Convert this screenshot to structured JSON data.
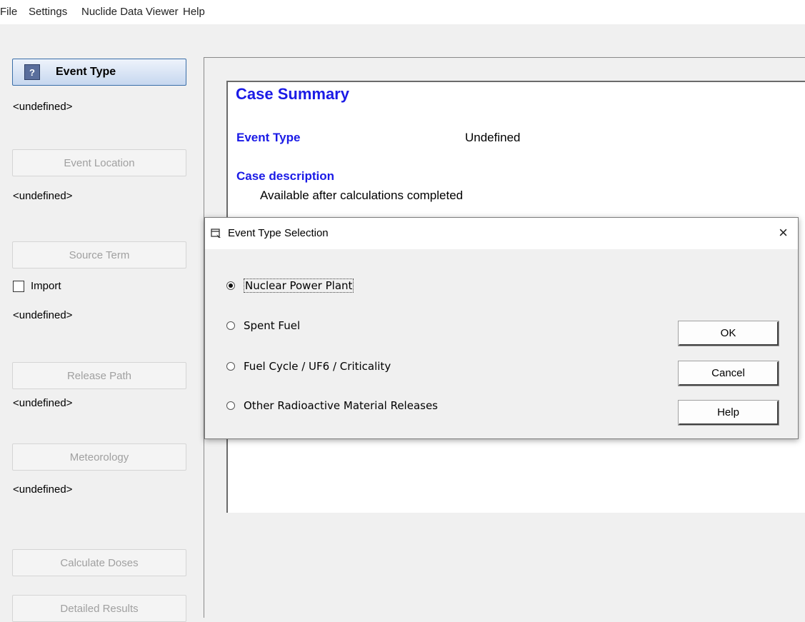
{
  "menu": [
    "File",
    "Settings",
    "Nuclide Data Viewer",
    "Help"
  ],
  "sidebar": {
    "event_type": {
      "icon_text": "?",
      "label": "Event Type",
      "status": "<undefined>"
    },
    "event_location": {
      "label": "Event Location",
      "status": "<undefined>"
    },
    "source_term": {
      "label": "Source Term",
      "import_label": "Import",
      "import_checked": false,
      "status": "<undefined>"
    },
    "release_path": {
      "label": "Release Path",
      "status": "<undefined>"
    },
    "meteorology": {
      "label": "Meteorology",
      "status": "<undefined>"
    },
    "calculate_doses": {
      "label": "Calculate Doses"
    },
    "detailed_results": {
      "label": "Detailed Results"
    }
  },
  "summary": {
    "title": "Case Summary",
    "event_type_label": "Event Type",
    "event_type_value": "Undefined",
    "case_description_label": "Case description",
    "case_description_value": "Available after calculations completed"
  },
  "dialog": {
    "title": "Event Type Selection",
    "close_glyph": "×",
    "options": [
      {
        "label": "Nuclear Power Plant",
        "selected": true
      },
      {
        "label": "Spent Fuel",
        "selected": false
      },
      {
        "label": "Fuel Cycle / UF6 / Criticality",
        "selected": false
      },
      {
        "label": "Other Radioactive Material Releases",
        "selected": false
      }
    ],
    "buttons": {
      "ok": "OK",
      "cancel": "Cancel",
      "help": "Help"
    }
  }
}
